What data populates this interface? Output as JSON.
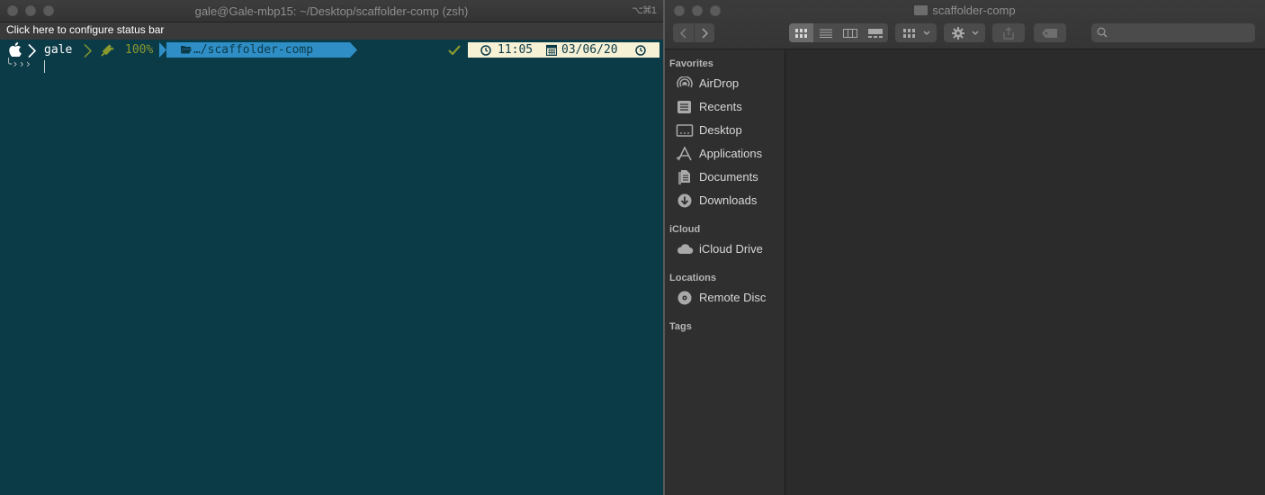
{
  "terminal": {
    "title": "gale@Gale-mbp15: ~/Desktop/scaffolder-comp (zsh)",
    "shortcut": "⌥⌘1",
    "status_bar": "Click here to configure status bar",
    "prompt": {
      "user": "gale",
      "battery": "100%",
      "path": "…/scaffolder-comp",
      "time": "11:05",
      "date": "03/06/20"
    },
    "second_line": "╰›››"
  },
  "finder": {
    "title": "scaffolder-comp",
    "sections": {
      "favorites": "Favorites",
      "icloud": "iCloud",
      "locations": "Locations",
      "tags": "Tags"
    },
    "favorites": [
      "AirDrop",
      "Recents",
      "Desktop",
      "Applications",
      "Documents",
      "Downloads"
    ],
    "icloud_items": [
      "iCloud Drive"
    ],
    "locations_items": [
      "Remote Disc"
    ]
  },
  "colors": {
    "terminal_bg": "#0c3b48",
    "path_segment": "#2f8ec6",
    "time_segment": "#f6f0d4",
    "battery_green": "#8a9a2e"
  }
}
